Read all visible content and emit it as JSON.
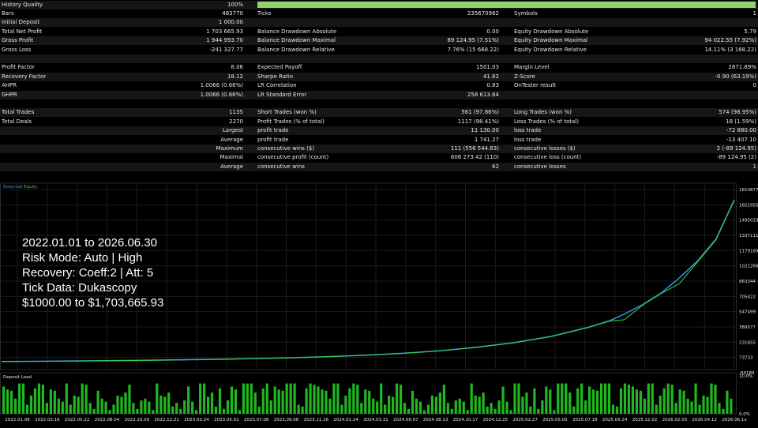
{
  "stats": {
    "rows": [
      [
        {
          "l": "History Quality",
          "v": "100%"
        },
        {
          "l": "",
          "v": ""
        },
        {
          "l": "",
          "v": ""
        }
      ],
      [
        {
          "l": "Bars",
          "v": "463770"
        },
        {
          "l": "Ticks",
          "v": "235670982"
        },
        {
          "l": "Symbols",
          "v": "1"
        }
      ],
      [
        {
          "l": "Initial Deposit",
          "v": "1 000.00"
        },
        {
          "l": "",
          "v": ""
        },
        {
          "l": "",
          "v": ""
        }
      ],
      [
        {
          "l": "Total Net Profit",
          "v": "1 703 665.93"
        },
        {
          "l": "Balance Drawdown Absolute",
          "v": "0.00"
        },
        {
          "l": "Equity Drawdown Absolute",
          "v": "5.79"
        }
      ],
      [
        {
          "l": "Gross Profit",
          "v": "1 944 993.70"
        },
        {
          "l": "Balance Drawdown Maximal",
          "v": "89 124.95 (7.51%)"
        },
        {
          "l": "Equity Drawdown Maximal",
          "v": "94 022.55 (7.92%)"
        }
      ],
      [
        {
          "l": "Gross Loss",
          "v": "-241 327.77"
        },
        {
          "l": "Balance Drawdown Relative",
          "v": "7.76% (15 668.22)"
        },
        {
          "l": "Equity Drawdown Relative",
          "v": "14.11% (3 168.22)"
        }
      ],
      [
        {
          "l": "",
          "v": ""
        },
        {
          "l": "",
          "v": ""
        },
        {
          "l": "",
          "v": ""
        }
      ],
      [
        {
          "l": "Profit Factor",
          "v": "8.06"
        },
        {
          "l": "Expected Payoff",
          "v": "1501.03"
        },
        {
          "l": "Margin Level",
          "v": "2871.89%"
        }
      ],
      [
        {
          "l": "Recovery Factor",
          "v": "18.12"
        },
        {
          "l": "Sharpe Ratio",
          "v": "41.62"
        },
        {
          "l": "Z-Score",
          "v": "-0.90 (63.19%)"
        }
      ],
      [
        {
          "l": "AHPR",
          "v": "1.0066 (0.66%)"
        },
        {
          "l": "LR Correlation",
          "v": "0.83"
        },
        {
          "l": "OnTester result",
          "v": "0"
        }
      ],
      [
        {
          "l": "GHPR",
          "v": "1.0066 (0.66%)"
        },
        {
          "l": "LR Standard Error",
          "v": "258 613.64"
        },
        {
          "l": "",
          "v": ""
        }
      ],
      [
        {
          "l": "",
          "v": ""
        },
        {
          "l": "",
          "v": ""
        },
        {
          "l": "",
          "v": ""
        }
      ],
      [
        {
          "l": "Total Trades",
          "v": "1135"
        },
        {
          "l": "Short Trades (won %)",
          "v": "561 (97.86%)"
        },
        {
          "l": "Long Trades (won %)",
          "v": "574 (98.95%)"
        }
      ],
      [
        {
          "l": "Total Deals",
          "v": "2270"
        },
        {
          "l": "Profit Trades (% of total)",
          "v": "1117 (98.41%)"
        },
        {
          "l": "Loss Trades (% of total)",
          "v": "18 (1.59%)"
        }
      ],
      [
        {
          "l": "Largest",
          "v": ""
        },
        {
          "l": "profit trade",
          "v": "11 130.00"
        },
        {
          "l": "loss trade",
          "v": "-72 880.00"
        }
      ],
      [
        {
          "l": "Average",
          "v": ""
        },
        {
          "l": "profit trade",
          "v": "1 741.27"
        },
        {
          "l": "loss trade",
          "v": "-13 407.10"
        }
      ],
      [
        {
          "l": "Maximum",
          "v": ""
        },
        {
          "l": "consecutive wins ($)",
          "v": "111 (556 544.63)"
        },
        {
          "l": "consecutive losses ($)",
          "v": "2 (-89 124.95)"
        }
      ],
      [
        {
          "l": "Maximal",
          "v": ""
        },
        {
          "l": "consecutive profit (count)",
          "v": "606 273.42 (110)"
        },
        {
          "l": "consecutive loss (count)",
          "v": "-89 124.95 (2)"
        }
      ],
      [
        {
          "l": "Average",
          "v": ""
        },
        {
          "l": "consecutive wins",
          "v": "62"
        },
        {
          "l": "consecutive losses",
          "v": "1"
        }
      ]
    ],
    "right_aligned_labels": [
      "Largest",
      "Average",
      "Maximum",
      "Maximal"
    ],
    "quality_fill": 1.0
  },
  "overlay": {
    "line1": "2022.01.01 to 2026.06.30",
    "line2": "Risk Mode: Auto | High",
    "line3": "Recovery: Coeff:2 | Att: 5",
    "line4": "Tick Data: Dukascopy",
    "line5": "$1000.00 to $1,703,665.93"
  },
  "chart_data": [
    {
      "type": "line",
      "title": "",
      "legend": [
        "Balance",
        "Equity"
      ],
      "legend_placement": "top-left",
      "ylim": [
        -84189,
        1810877
      ],
      "y_ticks": [
        "1810877",
        "1652955",
        "1495033",
        "1337111",
        "1179189",
        "1021266",
        "863344",
        "705422",
        "547499",
        "389577",
        "231655",
        "73733",
        "-84189"
      ],
      "x_ticks": [
        "2022.01.08",
        "2022.03.16",
        "2022.05.22",
        "2022.08.04",
        "2022.10.09",
        "2022.12.21",
        "2023.02.24",
        "2023.05.02",
        "2023.07.08",
        "2023.09.08",
        "2023.11.16",
        "2024.01.24",
        "2024.03.31",
        "2024.06.07",
        "2024.08.13",
        "2024.10.17",
        "2024.12.25",
        "2025.02.27",
        "2025.05.05",
        "2025.07.18",
        "2025.09.24",
        "2025.12.02",
        "2026.02.03",
        "2026.04.12",
        "2026.06.1x"
      ],
      "series": [
        {
          "name": "Balance",
          "color": "#2a8fd8",
          "x": [
            0,
            0.05,
            0.1,
            0.15,
            0.2,
            0.25,
            0.3,
            0.35,
            0.4,
            0.45,
            0.5,
            0.55,
            0.6,
            0.65,
            0.7,
            0.75,
            0.8,
            0.83,
            0.85,
            0.875,
            0.9,
            0.925,
            0.95,
            0.975,
            1.0
          ],
          "values": [
            1000,
            3000,
            6000,
            10000,
            14000,
            19000,
            25000,
            32000,
            41000,
            53000,
            68000,
            88000,
            115000,
            152000,
            200000,
            265000,
            360000,
            430000,
            500000,
            600000,
            720000,
            880000,
            1060000,
            1290000,
            1703666
          ]
        },
        {
          "name": "Equity",
          "color": "#3fcf3f",
          "x": [
            0,
            0.05,
            0.1,
            0.15,
            0.2,
            0.25,
            0.3,
            0.35,
            0.4,
            0.45,
            0.5,
            0.55,
            0.6,
            0.65,
            0.7,
            0.75,
            0.8,
            0.83,
            0.85,
            0.875,
            0.9,
            0.925,
            0.95,
            0.975,
            1.0
          ],
          "values": [
            995,
            2980,
            5950,
            9950,
            13900,
            18900,
            24850,
            31800,
            40800,
            52700,
            67600,
            87500,
            114000,
            150500,
            198000,
            262000,
            356000,
            426000,
            440000,
            595000,
            715000,
            820000,
            1050000,
            1280000,
            1700000
          ]
        }
      ]
    },
    {
      "type": "bar",
      "title": "Deposit Load",
      "ylim": [
        0,
        10.0
      ],
      "y_ticks": [
        "10.0%",
        "0.0%"
      ],
      "pattern_values": [
        4.5,
        2.5,
        5.0,
        1.5,
        3.5,
        5.0,
        0.8,
        4.0,
        2.0,
        5.0,
        3.0,
        1.2,
        4.8,
        2.2,
        3.8,
        0.6,
        5.0,
        2.8,
        4.2,
        1.8
      ]
    }
  ],
  "colors": {
    "background": "#000000",
    "grid": "#1c1c1c",
    "text": "#e8e8e8",
    "band": "#161616",
    "quality": "#8fd46a",
    "bars": "#1fb81f",
    "balance": "#2a8fd8",
    "equity": "#3fcf3f"
  }
}
